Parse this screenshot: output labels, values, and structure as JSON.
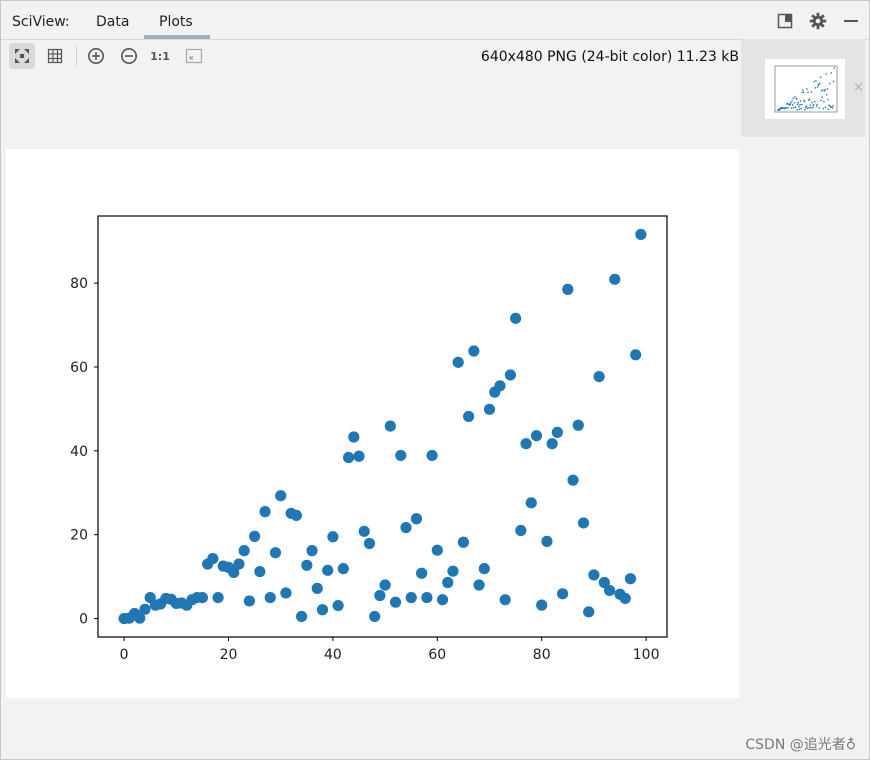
{
  "header": {
    "title": "SciView:",
    "tabs": [
      {
        "label": "Data",
        "active": false
      },
      {
        "label": "Plots",
        "active": true
      }
    ],
    "icons": [
      "restore-layout-icon",
      "gear-icon",
      "minimize-icon"
    ]
  },
  "toolbar": {
    "icons": [
      "fit-window-icon",
      "grid-icon",
      "zoom-in-icon",
      "zoom-out-icon",
      "actual-size-icon",
      "fit-to-view-icon"
    ],
    "actual_size_label": "1:1",
    "image_info": "640x480 PNG (24-bit color) 11.23 kB"
  },
  "thumbnail": {
    "close_label": "×"
  },
  "colors": {
    "accent_tab": "#a0adbf",
    "point": "#1f77b4",
    "active_button_bg": "#d9d9d9"
  },
  "watermark": "CSDN @追光者♁",
  "chart_data": {
    "type": "scatter",
    "title": "",
    "xlabel": "",
    "ylabel": "",
    "xlim": [
      -5,
      104
    ],
    "ylim": [
      -4.4,
      96
    ],
    "x_ticks": [
      0,
      20,
      40,
      60,
      80,
      100
    ],
    "y_ticks": [
      0,
      20,
      40,
      60,
      80
    ],
    "grid": false,
    "series": [
      {
        "color": "#1f77b4",
        "x": [
          0,
          1,
          2,
          3,
          4,
          5,
          6,
          7,
          8,
          9,
          10,
          11,
          12,
          13,
          14,
          15,
          16,
          17,
          18,
          19,
          20,
          21,
          22,
          23,
          24,
          25,
          26,
          27,
          28,
          29,
          30,
          31,
          32,
          33,
          34,
          35,
          36,
          37,
          38,
          39,
          40,
          41,
          42,
          43,
          44,
          45,
          46,
          47,
          48,
          49,
          50,
          51,
          52,
          53,
          54,
          55,
          56,
          57,
          58,
          59,
          60,
          61,
          62,
          63,
          64,
          65,
          66,
          67,
          68,
          69,
          70,
          71,
          72,
          73,
          74,
          75,
          76,
          77,
          78,
          79,
          80,
          81,
          82,
          83,
          84,
          85,
          86,
          87,
          88,
          89,
          90,
          91,
          92,
          93,
          94,
          95,
          96,
          97,
          98,
          99
        ],
        "y": [
          0,
          0.1,
          1.2,
          0.1,
          2.2,
          5,
          3.2,
          3.5,
          4.8,
          4.6,
          3.6,
          3.7,
          3.2,
          4.5,
          5,
          5,
          13,
          14.3,
          5,
          12.5,
          12.2,
          11,
          13,
          16.2,
          4.2,
          19.6,
          11.2,
          25.5,
          5,
          15.7,
          29.3,
          6.1,
          25.1,
          24.6,
          0.5,
          12.7,
          16.2,
          7.2,
          2.1,
          11.5,
          19.5,
          3.1,
          11.9,
          38.4,
          43.3,
          38.7,
          20.8,
          17.9,
          0.5,
          5.5,
          8,
          45.9,
          3.9,
          38.9,
          21.7,
          5,
          23.8,
          10.8,
          5,
          38.9,
          16.3,
          4.5,
          8.6,
          11.3,
          61.1,
          18.2,
          48.2,
          63.8,
          8,
          11.9,
          49.9,
          54,
          55.5,
          4.5,
          58.1,
          71.6,
          21,
          41.7,
          27.6,
          43.6,
          3.2,
          18.4,
          41.7,
          44.4,
          5.9,
          78.5,
          33,
          46.1,
          22.8,
          1.6,
          10.4,
          57.7,
          8.6,
          6.7,
          80.9,
          5.8,
          4.8,
          9.5,
          62.9,
          91.6
        ]
      }
    ]
  }
}
